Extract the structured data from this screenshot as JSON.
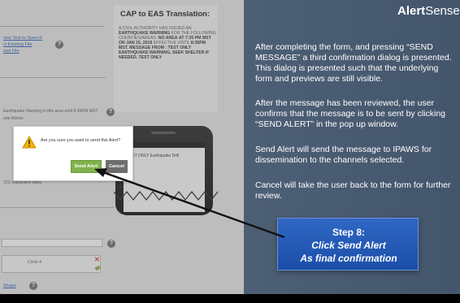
{
  "brand": {
    "logo_bold": "Alert",
    "logo_rest": "Sense"
  },
  "screenshot": {
    "cap_title": "CAP to EAS Translation:",
    "cap_body_1": "A civil authority has issued an",
    "cap_body_2": "Earthquake Warning",
    "cap_body_3": "for the following counties/areas:",
    "cap_body_4": "No Area",
    "cap_body_5": "at 7:35 PM MST on Jan 15, 2019",
    "cap_body_6": "effective until",
    "cap_body_7": "8:35PM MST.",
    "cap_body_8": "Message from : TEST ONLY EARTHQUAKE WARNING, SEEK SHELTER IF NEEDED. TEST ONLY",
    "link_1": "new Text to Speech",
    "link_2": "ct Existing File",
    "link_3": "oad File",
    "row_text": "Earthquake Warning in this area until 8:30PM MST",
    "row_text_2": "ode Admin",
    "chars_used": "150 characters used.",
    "phone_msg": "TEST ONLY Earthquake Drill",
    "circle_label": "Circle 4",
    "bottom_link": "Shape"
  },
  "dialog": {
    "question": "Are you sure you want to send this Alert?",
    "send_label": "Send Alert",
    "cancel_label": "Cancel"
  },
  "text": {
    "p1": "After completing the form, and pressing “SEND MESSAGE” a third confirmation dialog is presented.  This dialog is presented  such that the underlying form and previews are still visible.",
    "p2": "After the message has been reviewed, the user confirms that the message is to be sent by clicking “SEND ALERT” in the pop up window.",
    "p3": "Send Alert will send the message to IPAWS for dissemination to the channels selected.",
    "p4": "Cancel will take the user back to the form for further review."
  },
  "callout": {
    "step": "Step 8:",
    "line1": "Click Send Alert",
    "line2": "As final confirmation"
  },
  "colors": {
    "background": "#4f6177",
    "callout": "#1b4ea8",
    "send_button": "#7fb24a",
    "cancel_button": "#6d6d6d"
  }
}
